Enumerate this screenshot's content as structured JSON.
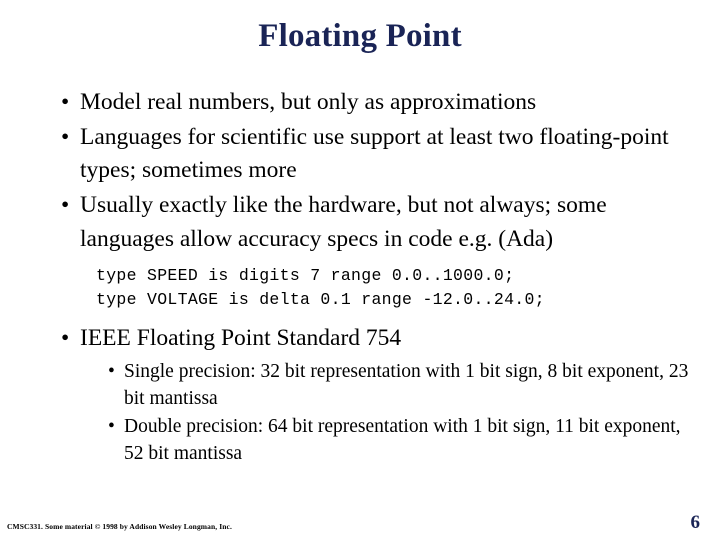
{
  "slide": {
    "title": "Floating Point",
    "title_color": "#1a2456",
    "page_number": "6",
    "background_color": "#ffffff",
    "text_color": "#000000"
  },
  "bullets": {
    "b1": "Model real numbers, but only as approximations",
    "b2": "Languages for scientific use support at least two floating-point types; sometimes more",
    "b3": "Usually exactly like the hardware, but not always; some languages allow accuracy specs in code e.g. (Ada)",
    "b4": "IEEE Floating Point Standard 754",
    "marker": "•"
  },
  "code": {
    "line1": "type SPEED is digits 7 range 0.0..1000.0;",
    "line2": "type VOLTAGE is delta 0.1 range -12.0..24.0;"
  },
  "subbullets": {
    "s1": "Single precision:  32 bit representation with 1 bit sign, 8 bit exponent, 23 bit mantissa",
    "s2": "Double precision: 64 bit representation with 1 bit sign, 11 bit exponent, 52 bit mantissa",
    "marker": "•"
  },
  "footer": {
    "credit": "CMSC331. Some material © 1998 by Addison Wesley Longman, Inc."
  }
}
